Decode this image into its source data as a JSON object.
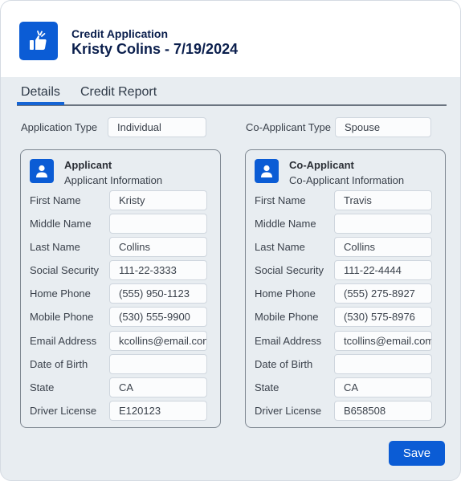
{
  "header": {
    "subtitle": "Credit Application",
    "title": "Kristy Colins - 7/19/2024",
    "icon": "thumbs-up-icon",
    "accent_color": "#0b5cd5"
  },
  "tabs": [
    {
      "label": "Details",
      "active": true
    },
    {
      "label": "Credit Report",
      "active": false
    }
  ],
  "top_fields": {
    "application_type_label": "Application Type",
    "application_type_value": "Individual",
    "co_applicant_type_label": "Co-Applicant Type",
    "co_applicant_type_value": "Spouse"
  },
  "applicant": {
    "title": "Applicant",
    "subtitle": "Applicant Information",
    "icon": "person-icon",
    "fields": [
      {
        "label": "First Name",
        "value": "Kristy"
      },
      {
        "label": "Middle Name",
        "value": ""
      },
      {
        "label": "Last Name",
        "value": "Collins"
      },
      {
        "label": "Social Security",
        "value": "111-22-3333"
      },
      {
        "label": "Home Phone",
        "value": "(555) 950-1123"
      },
      {
        "label": "Mobile Phone",
        "value": "(530) 555-9900"
      },
      {
        "label": "Email Address",
        "value": "kcollins@email.com"
      },
      {
        "label": "Date of Birth",
        "value": ""
      },
      {
        "label": "State",
        "value": "CA"
      },
      {
        "label": "Driver License",
        "value": "E120123"
      }
    ]
  },
  "co_applicant": {
    "title": "Co-Applicant",
    "subtitle": "Co-Applicant Information",
    "icon": "person-icon",
    "fields": [
      {
        "label": "First Name",
        "value": "Travis"
      },
      {
        "label": "Middle Name",
        "value": ""
      },
      {
        "label": "Last Name",
        "value": "Collins"
      },
      {
        "label": "Social Security",
        "value": "111-22-4444"
      },
      {
        "label": "Home Phone",
        "value": "(555) 275-8927"
      },
      {
        "label": "Mobile Phone",
        "value": "(530) 575-8976"
      },
      {
        "label": "Email Address",
        "value": "tcollins@email.com"
      },
      {
        "label": "Date of Birth",
        "value": ""
      },
      {
        "label": "State",
        "value": "CA"
      },
      {
        "label": "Driver License",
        "value": "B658508"
      }
    ]
  },
  "actions": {
    "save_label": "Save"
  }
}
